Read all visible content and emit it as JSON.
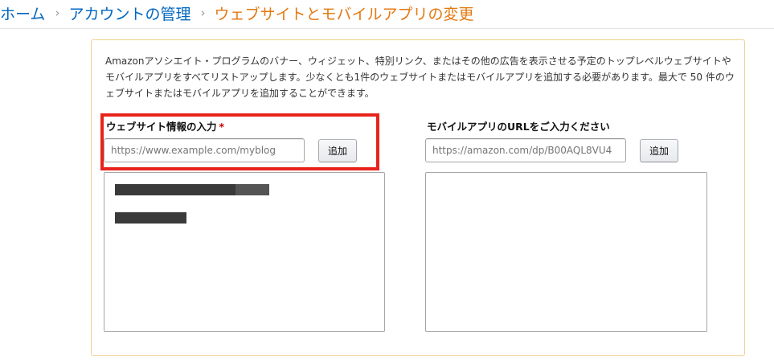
{
  "breadcrumb": {
    "home": "ホーム",
    "separator": "›",
    "account": "アカウントの管理",
    "current": "ウェブサイトとモバイルアプリの変更"
  },
  "intro_text": "Amazonアソシエイト・プログラムのバナー、ウィジェット、特別リンク、またはその他の広告を表示させる予定のトップレベルウェブサイトやモバイルアプリをすべてリストアップします。少なくとも1件のウェブサイトまたはモバイルアプリを追加する必要があります。最大で 50 件のウェブサイトまたはモバイルアプリを追加することができます。",
  "website": {
    "label": "ウェブサイト情報の入力",
    "required_mark": "*",
    "placeholder": "https://www.example.com/myblog",
    "add_button": "追加",
    "entries_redacted": 2
  },
  "mobile": {
    "label": "モバイルアプリのURLをご入力ください",
    "placeholder": "https://amazon.com/dp/B00AQL8VU4",
    "add_button": "追加"
  },
  "colors": {
    "link": "#0066c0",
    "current_crumb": "#e47911",
    "panel_border": "#f1cf8f",
    "highlight": "#e8231b",
    "required": "#c40000"
  }
}
